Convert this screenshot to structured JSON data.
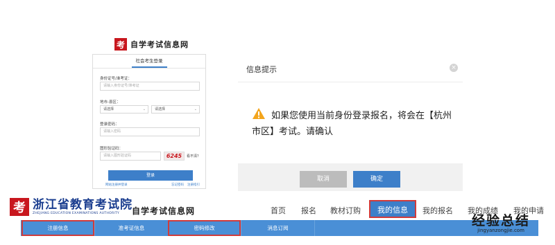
{
  "mini_logo": {
    "mark": "考",
    "name": "自学考试信息网"
  },
  "login": {
    "tab": "社会考生登录",
    "id_label": "身份证号/准考证：",
    "id_placeholder": "请输入身份证号/准考证",
    "city_label": "地市-县区：",
    "city_select": "请选择",
    "district_select": "请选择",
    "password_label": "登录密码：",
    "password_placeholder": "请输入密码",
    "captcha_label": "图形验证码：",
    "captcha_placeholder": "请输入图形验证码",
    "captcha_code": "6245",
    "cant_see": "看不清？",
    "login_button": "登录",
    "link_register": "网站注册并登录",
    "link_forgot": "忘记密码",
    "link_help": "注册指引"
  },
  "dialog": {
    "title": "信息提示",
    "close": "×",
    "message": "如果您使用当前身份登录报名，将会在【杭州市区】考试。请确认",
    "cancel_button": "取消",
    "ok_button": "确定"
  },
  "site": {
    "logo_mark": "考",
    "name": "浙江省教育考试院",
    "name_en": "ZHEJIANG EDUCATION EXAMINATIONS AUTHORITY",
    "sub": "自学考试信息网"
  },
  "top_nav": [
    "首页",
    "报名",
    "教材订购",
    "我的信息",
    "我的报名",
    "我的成绩",
    "我的申请"
  ],
  "sub_nav": [
    "注册信息",
    "准考证信息",
    "密码修改",
    "消息订阅"
  ],
  "watermark": {
    "main": "经验总结",
    "url": "jingyanzongjie.com"
  },
  "colors": {
    "primary": "#3d7fc9",
    "highlight_border": "#d03b3b",
    "brand_red": "#c8171e",
    "brand_blue": "#1a3d8f"
  }
}
